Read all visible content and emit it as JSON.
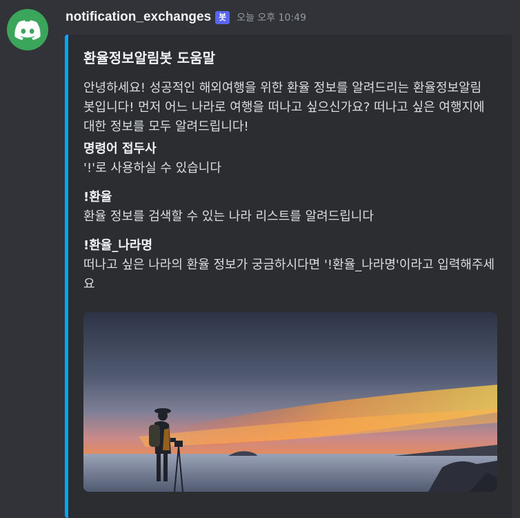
{
  "message": {
    "username": "notification_exchanges",
    "bot_tag": "봇",
    "timestamp": "오늘 오후 10:49",
    "avatar_icon": "discord-logo-icon",
    "avatar_color": "#3ba55c"
  },
  "embed": {
    "accent_color": "#00a8fc",
    "title": "환율정보알림봇 도움말",
    "description": "안녕하세요! 성공적인 해외여행을 위한 환율 정보를 알려드리는 환율정보알림봇입니다! 먼저 어느 나라로 여행을 떠나고 싶으신가요? 떠나고 싶은 여행지에 대한 정보를 모두 알려드립니다!",
    "fields": [
      {
        "name": "명령어 접두사",
        "value": "'!'로 사용하실 수 있습니다"
      },
      {
        "name": "!환율",
        "value": "환율 정보를 검색할 수 있는 나라 리스트를 알려드립니다"
      },
      {
        "name": "!환율_나라명",
        "value": "떠나고 싶은 나라의 환율 정보가 궁금하시다면 '!환율_나라명'이라고 입력해주세요"
      }
    ],
    "image": "sunset-traveler-photo"
  }
}
